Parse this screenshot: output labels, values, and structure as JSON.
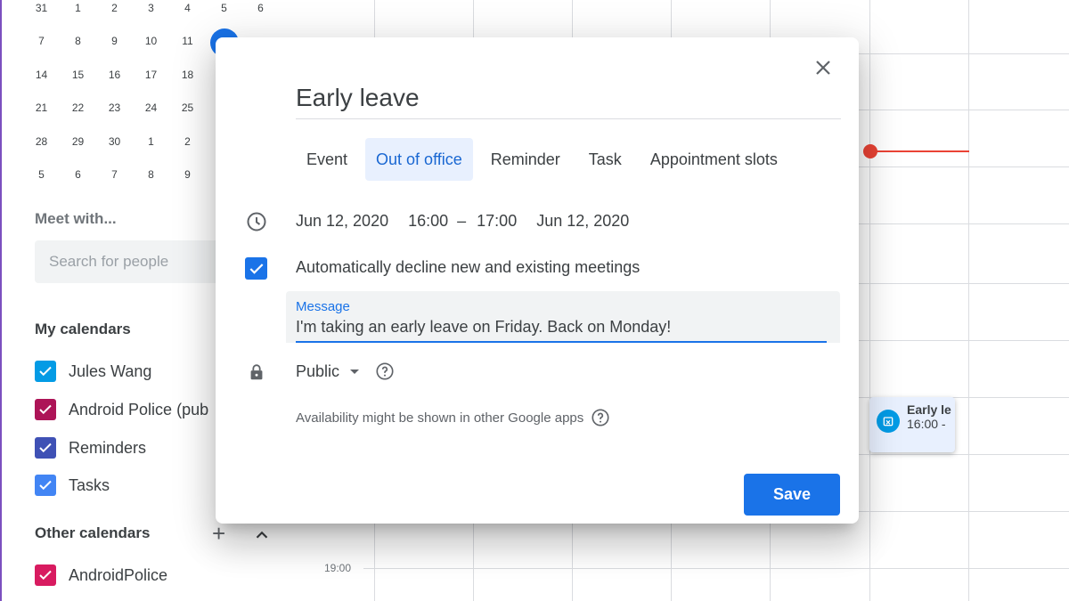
{
  "mini_calendar": {
    "rows": [
      [
        "31",
        "1",
        "2",
        "3",
        "4",
        "5",
        "6"
      ],
      [
        "7",
        "8",
        "9",
        "10",
        "11",
        "",
        ""
      ],
      [
        "14",
        "15",
        "16",
        "17",
        "18",
        "",
        ""
      ],
      [
        "21",
        "22",
        "23",
        "24",
        "25",
        "",
        ""
      ],
      [
        "28",
        "29",
        "30",
        "1",
        "2",
        "",
        ""
      ],
      [
        "5",
        "6",
        "7",
        "8",
        "9",
        "",
        ""
      ]
    ]
  },
  "sidebar": {
    "meet_title": "Meet with...",
    "search_placeholder": "Search for people",
    "my_calendars_title": "My calendars",
    "my_calendars": [
      {
        "label": "Jules Wang",
        "color": "#039be5"
      },
      {
        "label": "Android Police (pub",
        "color": "#ad1457"
      },
      {
        "label": "Reminders",
        "color": "#3f51b5"
      },
      {
        "label": "Tasks",
        "color": "#4285f4"
      }
    ],
    "other_calendars_title": "Other calendars",
    "other_calendars": [
      {
        "label": "AndroidPolice",
        "color": "#d81b60"
      }
    ]
  },
  "grid": {
    "time_label": "19:00"
  },
  "event_chip": {
    "title": "Early le",
    "time": "16:00 -"
  },
  "dialog": {
    "title": "Early leave",
    "tabs": [
      {
        "label": "Event",
        "active": false
      },
      {
        "label": "Out of office",
        "active": true
      },
      {
        "label": "Reminder",
        "active": false
      },
      {
        "label": "Task",
        "active": false
      },
      {
        "label": "Appointment slots",
        "active": false
      }
    ],
    "start_date": "Jun 12, 2020",
    "start_time": "16:00",
    "dash": "–",
    "end_time": "17:00",
    "end_date": "Jun 12, 2020",
    "decline_label": "Automatically decline new and existing meetings",
    "decline_checked": true,
    "message_label": "Message",
    "message_value": "I'm taking an early leave on Friday. Back on Monday!",
    "visibility": "Public",
    "availability_note": "Availability might be shown in other Google apps",
    "save_label": "Save"
  },
  "colors": {
    "accent": "#1a73e8",
    "now_line": "#ea4335"
  }
}
